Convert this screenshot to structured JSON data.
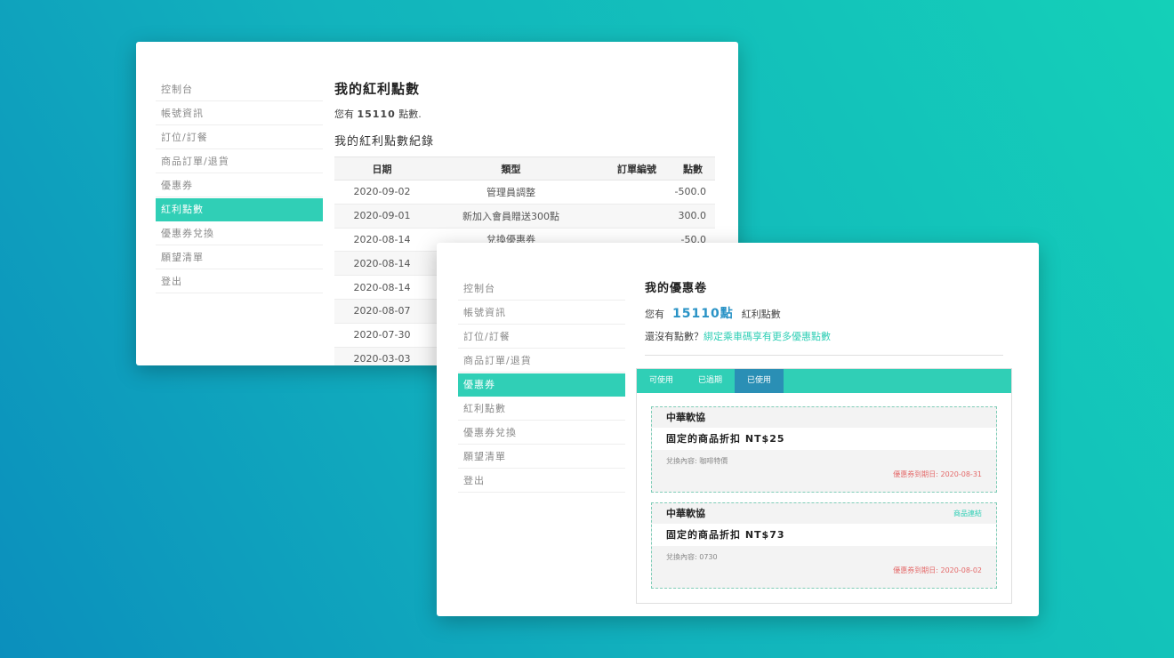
{
  "sidebar": {
    "items": [
      "控制台",
      "帳號資訊",
      "訂位/訂餐",
      "商品訂單/退貨",
      "優惠券",
      "紅利點數",
      "優惠券兌換",
      "願望清單",
      "登出"
    ]
  },
  "bonus": {
    "title": "我的紅利點數",
    "points_prefix": "您有",
    "points_value": "15110",
    "points_suffix": "點數.",
    "records_title": "我的紅利點數紀錄",
    "columns": [
      "日期",
      "類型",
      "訂單編號",
      "點數"
    ],
    "rows": [
      {
        "date": "2020-09-02",
        "type": "管理員調整",
        "order": "",
        "points": "-500.0"
      },
      {
        "date": "2020-09-01",
        "type": "新加入會員贈送300點",
        "order": "",
        "points": "300.0"
      },
      {
        "date": "2020-08-14",
        "type": "兌換優惠券",
        "order": "",
        "points": "-50.0"
      },
      {
        "date": "2020-08-14",
        "type": "",
        "order": "",
        "points": ""
      },
      {
        "date": "2020-08-14",
        "type": "",
        "order": "",
        "points": ""
      },
      {
        "date": "2020-08-07",
        "type": "",
        "order": "",
        "points": ""
      },
      {
        "date": "2020-07-30",
        "type": "",
        "order": "",
        "points": ""
      },
      {
        "date": "2020-03-03",
        "type": "",
        "order": "",
        "points": ""
      }
    ]
  },
  "coupons": {
    "title": "我的優惠卷",
    "points_prefix": "您有",
    "points_value": "15110點",
    "points_suffix": "紅利點數",
    "hint_prefix": "還沒有點數？",
    "hint_link": "綁定乘車碼享有更多優惠點數",
    "tabs": [
      "可使用",
      "已過期",
      "已使用"
    ],
    "active_tab": 2,
    "items": [
      {
        "vendor": "中華軟協",
        "link": "",
        "title": "固定的商品折扣 NT$25",
        "content": "兌換內容: 咖啡特價",
        "expire": "優惠券到期日: 2020-08-31"
      },
      {
        "vendor": "中華軟協",
        "link": "商品連結",
        "title": "固定的商品折扣 NT$73",
        "content": "兌換內容: 0730",
        "expire": "優惠券到期日: 2020-08-02"
      }
    ]
  },
  "colors": {
    "accent": "#30cfb6",
    "tab_active": "#2a8fb5",
    "points_highlight": "#2a93c6",
    "expire": "#e46a6a"
  }
}
